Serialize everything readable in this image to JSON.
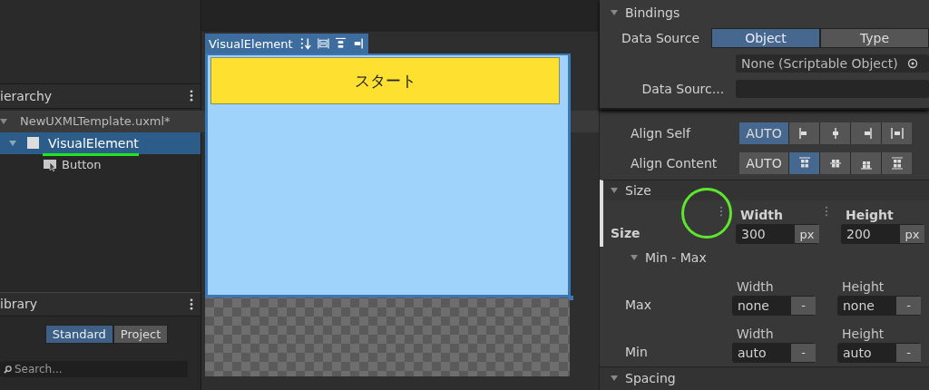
{
  "hierarchy": {
    "title": "ierarchy",
    "items": [
      {
        "label": "NewUXMLTemplate.uxml*",
        "kind": "root",
        "selected": false,
        "expanded": true,
        "children": [
          {
            "label": "VisualElement",
            "kind": "element",
            "selected": true,
            "expanded": true,
            "children": [
              {
                "label": "Button",
                "kind": "button",
                "selected": false
              }
            ]
          }
        ]
      }
    ]
  },
  "library": {
    "title": "ibrary",
    "tabs": [
      {
        "label": "Standard",
        "selected": true
      },
      {
        "label": "Project",
        "selected": false
      }
    ],
    "search": {
      "placeholder": "Search..."
    }
  },
  "canvas": {
    "tab_label": "VisualElement",
    "button_text": "スタート"
  },
  "bindings": {
    "title": "Bindings",
    "rows": [
      {
        "label": "Data Source",
        "kind": "segmented",
        "options": [
          {
            "label": "Object",
            "selected": true
          },
          {
            "label": "Type",
            "selected": false
          }
        ]
      },
      {
        "label": "",
        "kind": "object",
        "value": "None (Scriptable Object)"
      },
      {
        "label": "Data Sourc...",
        "kind": "field"
      }
    ]
  },
  "align": [
    {
      "label": "Align Self",
      "options": [
        {
          "label": "AUTO",
          "kind": "text",
          "selected": true
        },
        {
          "kind": "icon",
          "selected": false
        },
        {
          "kind": "icon",
          "selected": false
        },
        {
          "kind": "icon",
          "selected": false
        },
        {
          "kind": "icon",
          "selected": false
        }
      ]
    },
    {
      "label": "Align Content",
      "options": [
        {
          "label": "AUTO",
          "kind": "text",
          "selected": false
        },
        {
          "kind": "icon",
          "selected": true
        },
        {
          "kind": "icon",
          "selected": false
        },
        {
          "kind": "icon",
          "selected": false
        },
        {
          "kind": "icon",
          "selected": false
        }
      ]
    }
  ],
  "size": {
    "title": "Size",
    "label": "Size",
    "width": {
      "label": "Width",
      "value": "300",
      "unit": "px"
    },
    "height": {
      "label": "Height",
      "value": "200",
      "unit": "px"
    },
    "minmax": {
      "title": "Min - Max",
      "rows": [
        {
          "label": "Max",
          "width_label": "Width",
          "width": "none",
          "width_unit": "-",
          "height_label": "Height",
          "height": "none",
          "height_unit": "-"
        },
        {
          "label": "Min",
          "width_label": "Width",
          "width": "auto",
          "width_unit": "-",
          "height_label": "Height",
          "height": "auto",
          "height_unit": "-"
        }
      ]
    }
  },
  "next_section": "Spacing"
}
